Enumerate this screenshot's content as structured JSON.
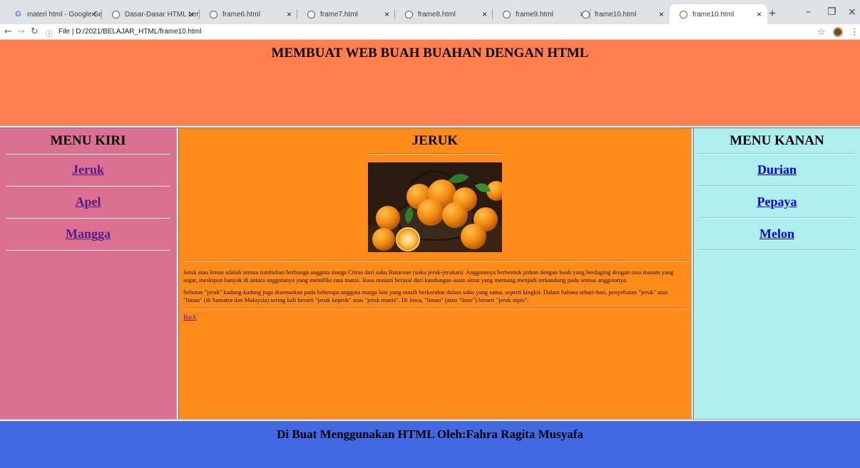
{
  "browser": {
    "tabs": [
      {
        "label": "materi html - Google Search",
        "icon": "google-icon"
      },
      {
        "label": "Dasar-Dasar HTML Lengkap",
        "icon": "globe-icon"
      },
      {
        "label": "frame6.html",
        "icon": "globe-icon"
      },
      {
        "label": "frame7.html",
        "icon": "globe-icon"
      },
      {
        "label": "frame8.html",
        "icon": "globe-icon"
      },
      {
        "label": "frame9.html",
        "icon": "globe-icon"
      },
      {
        "label": "frame10.html",
        "icon": "globe-icon"
      },
      {
        "label": "frame10.html",
        "icon": "globe-icon",
        "active": true
      }
    ],
    "close_glyph": "×",
    "new_tab_glyph": "+",
    "minimize_glyph": "–",
    "restore_glyph": "❐",
    "window_close_glyph": "×",
    "back_glyph": "←",
    "forward_glyph": "→",
    "reload_glyph": "↻",
    "url_info": "ⓘ",
    "url": "File  |  D:/2021/BELAJAR_HTML/frame10.html",
    "bookmark_glyph": "☆",
    "menu_glyph": "⋮"
  },
  "page": {
    "header_title": "MEMBUAT WEB BUAH BUAHAN DENGAN HTML",
    "left_menu": {
      "title": "MENU KIRI",
      "items": [
        "Jeruk",
        "Apel",
        "Mangga"
      ]
    },
    "right_menu": {
      "title": "MENU KANAN",
      "items": [
        "Durian",
        "Pepaya",
        "Melon"
      ]
    },
    "content": {
      "title": "JERUK",
      "paragraph1": "Jeruk atau limau adalah semua tumbuhan berbunga anggota marga Citrus dari suku Rutaceae (suku jeruk-jerukan). Anggotanya berbentuk pohon dengan buah yang berdaging dengan rasa masam yang segar, meskipun banyak di antara anggotanya yang memiliki rasa manis. Rasa masam berasal dari kandungan asam sitrat yang memang menjadi terkandung pada semua anggotanya.",
      "paragraph2": "Sebutan \"jeruk\" kadang-kadang juga disematkan pada beberapa anggota marga lain yang masih berkerabat dalam suku yang sama, seperti kingkit. Dalam bahasa sehari-hari, penyebutan \"jeruk\" atau \"limau\" (di Sumatra dan Malaysia) sering kali berarti \"jeruk keprok\" atau \"jeruk manis\". Di Jawa, \"limau\" (atau \"limo\") berarti \"jeruk nipis\".",
      "back_link": "Back"
    },
    "footer": "Di Buat Menggunakan HTML Oleh:Fahra Ragita Musyafa"
  },
  "colors": {
    "header_bg": "#ff7f50",
    "left_bg": "#db7093",
    "content_bg": "#ff8c1a",
    "right_bg": "#afeeee",
    "footer_bg": "#4169e1",
    "visited_link": "#551a8b",
    "link": "#0000ee"
  }
}
